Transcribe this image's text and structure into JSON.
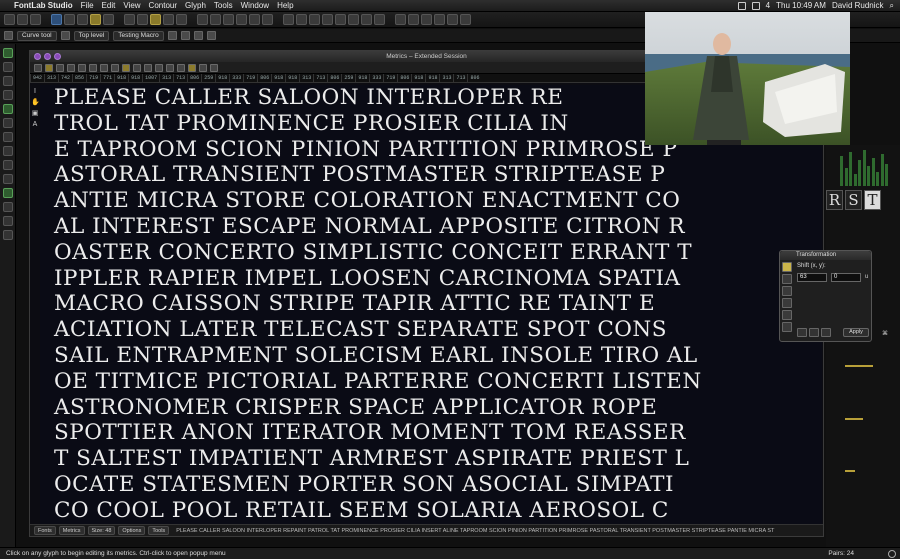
{
  "menubar": {
    "app_name": "FontLab Studio",
    "items": [
      "File",
      "Edit",
      "View",
      "Contour",
      "Glyph",
      "Tools",
      "Window",
      "Help"
    ],
    "battery": "4",
    "clock": "Thu 10:49 AM",
    "user": "David Rudnick"
  },
  "toolbar2": {
    "tool_select": "Curve tool",
    "level_select": "Top level",
    "macro_select": "Testing Macro"
  },
  "window": {
    "title": "Metrics – Extended Session",
    "ruler_values": [
      "942",
      "313",
      "742",
      "856",
      "719",
      "771",
      "918",
      "918",
      "1007",
      "313",
      "713",
      "806",
      "259",
      "918",
      "333",
      "719",
      "806",
      "918",
      "918",
      "313",
      "713",
      "806",
      "259",
      "918",
      "333",
      "719",
      "806",
      "918",
      "918",
      "313",
      "713",
      "806"
    ],
    "text_lines": [
      "PLEASE CALLER SALOON INTERLOPER RE",
      "TROL TAT PROMINENCE PROSIER CILIA IN",
      "E TAPROOM SCION PINION PARTITION PRIMROSE P",
      "ASTORAL TRANSIENT POSTMASTER STRIPTEASE P",
      "ANTIE MICRA STORE COLORATION ENACTMENT CO",
      "AL INTEREST ESCAPE NORMAL APPOSITE CITRON R",
      "OASTER CONCERTO SIMPLISTIC CONCEIT ERRANT T",
      "IPPLER RAPIER IMPEL LOOSEN CARCINOMA SPATIA",
      " MACRO CAISSON STRIPE TAPIR ATTIC RE TAINT E",
      "ACIATION LATER TELECAST SEPARATE SPOT CONS",
      "SAIL ENTRAPMENT SOLECISM EARL INSOLE TIRO AL",
      "OE TITMICE PICTORIAL PARTERRE CONCERTI LISTEN",
      " ASTRONOMER CRISPER SPACE APPLICATOR ROPE",
      "SPOTTIER ANON ITERATOR MOMENT TOM REASSER",
      "T SALTEST IMPATIENT ARMREST ASPIRATE PRIEST L",
      "OCATE STATESMEN PORTER SON ASOCIAL SIMPATI",
      "CO COOL POOL RETAIL SEEM SOLARIA AEROSOL C"
    ],
    "bottom_bar": {
      "fonts_label": "Fonts",
      "metrics_label": "Metrics",
      "size_label": "Size: 48",
      "options_label": "Options",
      "tools_label": "Tools",
      "preview_text": "PLEASE CALLER SALOON INTERLOPER REPAINT PATROL TAT PROMINENCE PROSIER CILIA INSERT ALINE TAPROOM SCION PINION PARTITION PRIMROSE PASTORAL TRANSIENT POSTMASTER STRIPTEASE PANTIE MICRA ST"
    }
  },
  "glyph_cells": [
    "R",
    "S",
    "T"
  ],
  "transformation": {
    "title": "Transformation",
    "shift_label": "Shift (x, y):",
    "x_value": "63",
    "y_value": "0",
    "unit": "u",
    "apply_label": "Apply"
  },
  "status": {
    "message": "Click on any glyph to begin editing its metrics. Ctrl-click to open popup menu",
    "pairs": "Pairs: 24"
  }
}
